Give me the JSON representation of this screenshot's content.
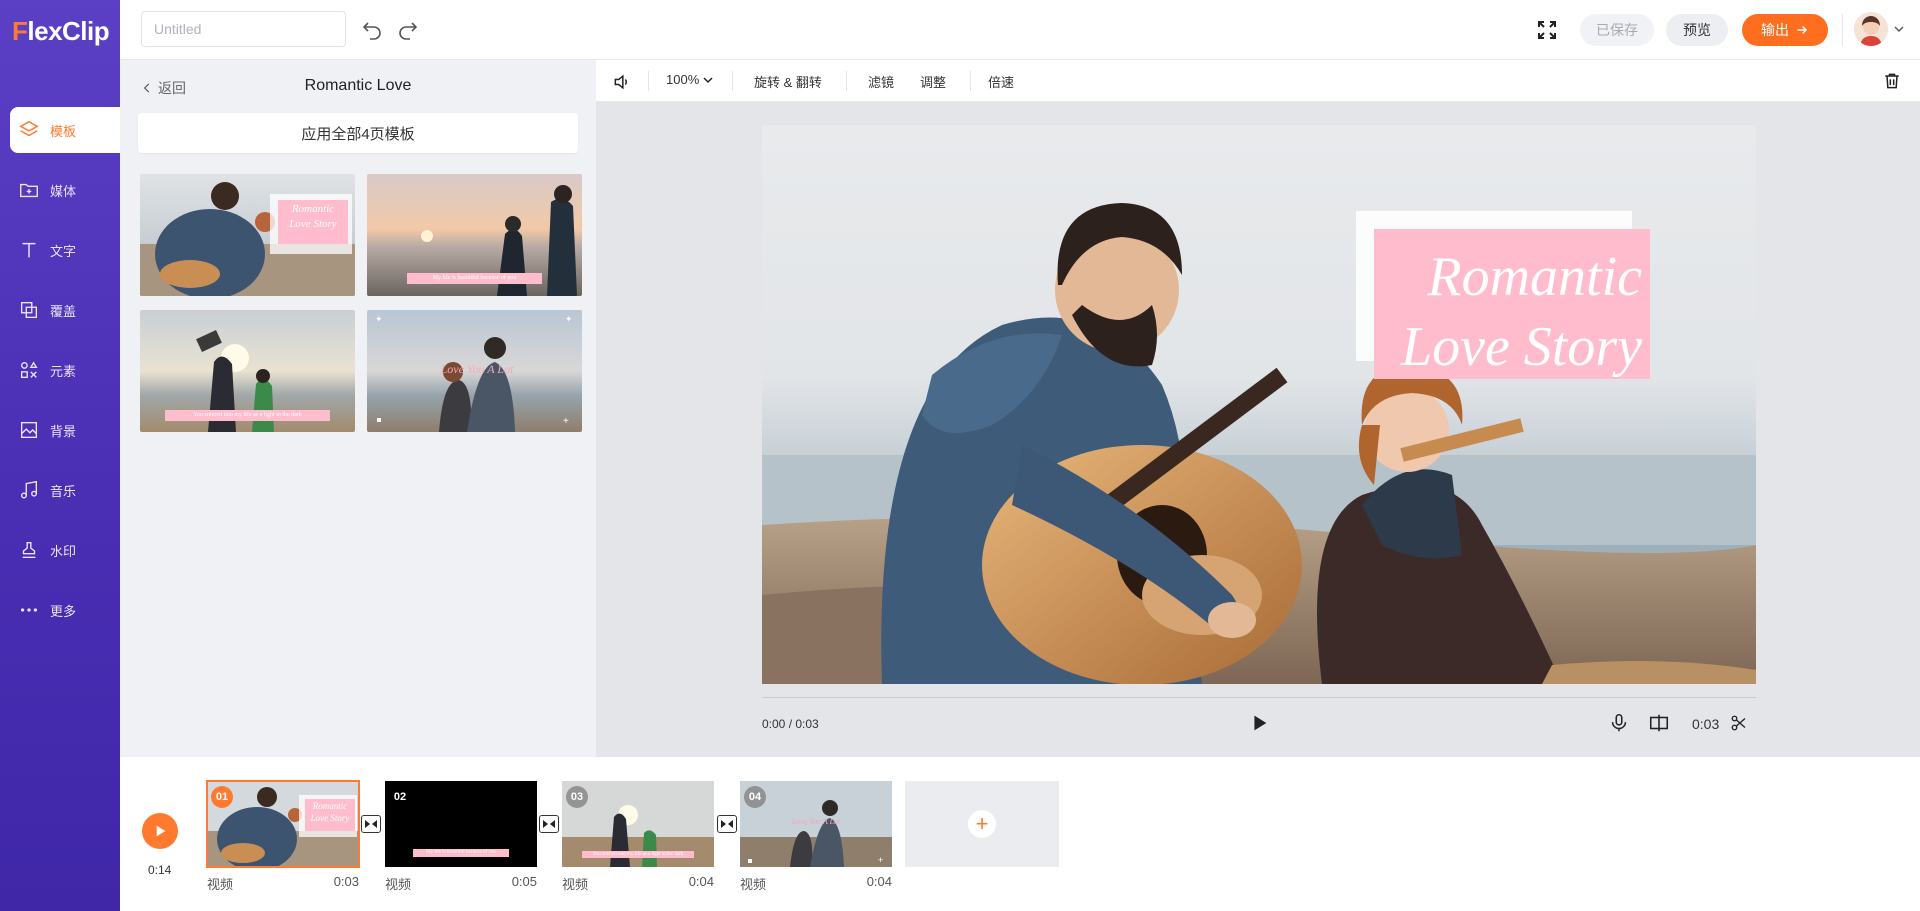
{
  "app": {
    "logo_prefix": "F",
    "logo_rest": "lexClip"
  },
  "sidebar": {
    "items": [
      {
        "label": "模板",
        "icon": "layers-icon",
        "active": true
      },
      {
        "label": "媒体",
        "icon": "folder-plus-icon"
      },
      {
        "label": "文字",
        "icon": "text-icon"
      },
      {
        "label": "覆盖",
        "icon": "overlay-icon"
      },
      {
        "label": "元素",
        "icon": "elements-icon"
      },
      {
        "label": "背景",
        "icon": "background-icon"
      },
      {
        "label": "音乐",
        "icon": "music-icon"
      },
      {
        "label": "水印",
        "icon": "stamp-icon"
      },
      {
        "label": "更多",
        "icon": "more-icon"
      }
    ]
  },
  "topbar": {
    "title_placeholder": "Untitled",
    "saved_label": "已保存",
    "preview_label": "预览",
    "export_label": "输出"
  },
  "panel": {
    "back_label": "返回",
    "title": "Romantic Love",
    "apply_label": "应用全部4页模板",
    "thumbs": [
      {
        "caption": "Romantic Love Story"
      },
      {
        "caption": "My life is beautiful because of you"
      },
      {
        "caption": "You entered into my life as a light in the dark"
      },
      {
        "caption": "Love You A Lot"
      }
    ]
  },
  "toolbar": {
    "zoom": "100%",
    "rotate_label": "旋转 & 翻转",
    "filter_label": "滤镜",
    "adjust_label": "调整",
    "speed_label": "倍速"
  },
  "canvas": {
    "title_line1": "Romantic",
    "title_line2": "Love Story",
    "accent": "#ffbccd"
  },
  "player": {
    "time": "0:00 / 0:03",
    "duration": "0:03"
  },
  "timeline": {
    "total": "0:14",
    "clips": [
      {
        "num": "01",
        "type": "视频",
        "duration": "0:03"
      },
      {
        "num": "02",
        "type": "视频",
        "duration": "0:05"
      },
      {
        "num": "03",
        "type": "视频",
        "duration": "0:04"
      },
      {
        "num": "04",
        "type": "视频",
        "duration": "0:04"
      }
    ],
    "add_symbol": "+"
  }
}
